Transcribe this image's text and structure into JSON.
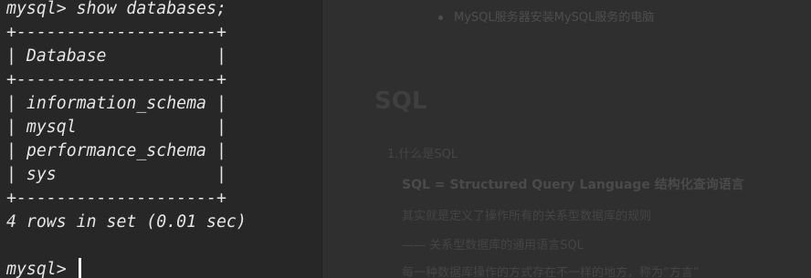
{
  "document": {
    "bullet_text": "MySQL服务器安装MySQL服务的电脑",
    "heading": "SQL",
    "lines": [
      "1.什么是SQL",
      "SQL = Structured Query Language 结构化查询语言",
      "其实就是定义了操作所有的关系型数据库的规则",
      "—— 关系型数据库的通用语言SQL",
      "每一种数据库操作的方式存在不一样的地方，称为“方言”"
    ]
  },
  "terminal": {
    "command_line": "mysql> show databases;",
    "separator": "+--------------------+",
    "header_row": "| Database           |",
    "rows": [
      "| information_schema |",
      "| mysql              |",
      "| performance_schema |",
      "| sys                |"
    ],
    "result_summary": "4 rows in set (0.01 sec)",
    "prompt": "mysql> "
  }
}
